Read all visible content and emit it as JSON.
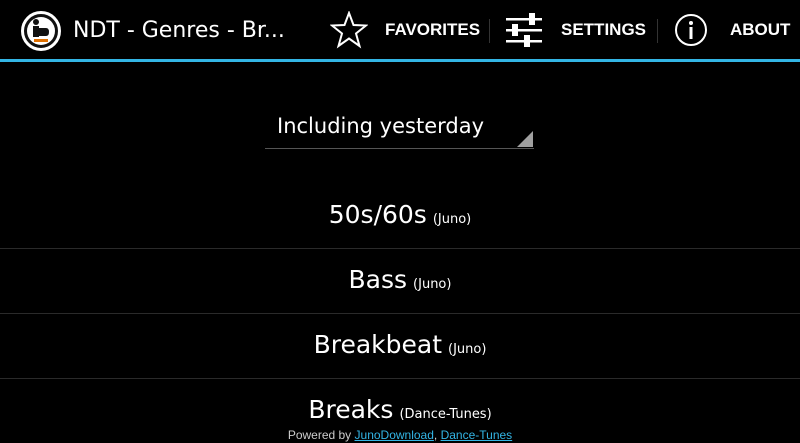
{
  "action_bar": {
    "title": "NDT - Genres - Br...",
    "actions": [
      {
        "label": "FAVORITES",
        "icon": "star-outline-icon"
      },
      {
        "label": "SETTINGS",
        "icon": "sliders-icon"
      },
      {
        "label": "ABOUT",
        "icon": "info-circle-icon"
      }
    ],
    "accent_color": "#33b5e5"
  },
  "filter": {
    "selected": "Including yesterday"
  },
  "genres": [
    {
      "name": "50s/60s",
      "source": "(Juno)"
    },
    {
      "name": "Bass",
      "source": "(Juno)"
    },
    {
      "name": "Breakbeat",
      "source": "(Juno)"
    },
    {
      "name": "Breaks",
      "source": "(Dance-Tunes)"
    }
  ],
  "footer": {
    "prefix": "Powered by ",
    "links": [
      "JunoDownload",
      "Dance-Tunes"
    ],
    "separator": ", "
  }
}
